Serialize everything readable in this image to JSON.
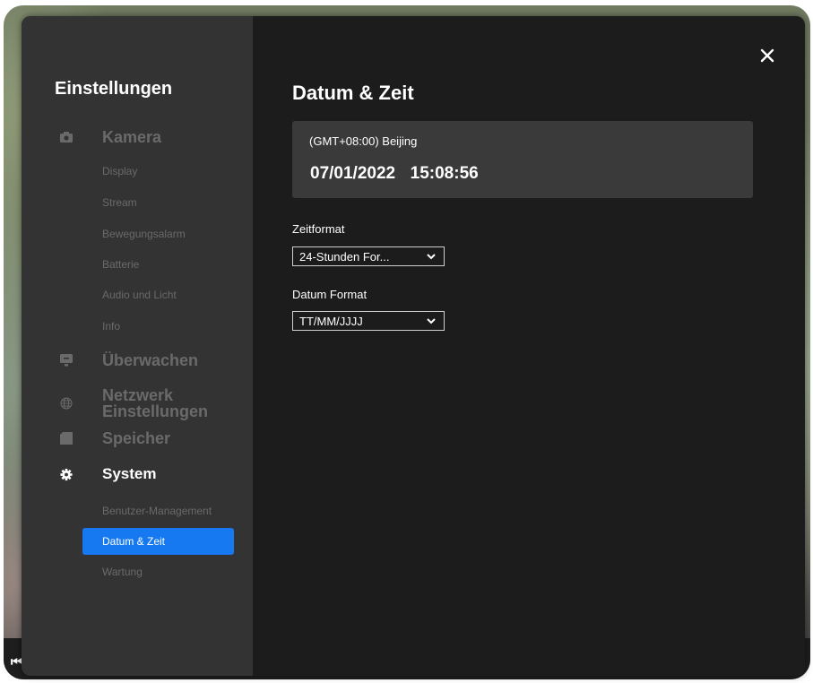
{
  "sidebar": {
    "title": "Einstellungen",
    "sections": {
      "camera": {
        "label": "Kamera",
        "icon": "camera-icon",
        "items": [
          "Display",
          "Stream",
          "Bewegungsalarm",
          "Batterie",
          "Audio und Licht",
          "Info"
        ]
      },
      "monitor": {
        "label": "Überwachen",
        "icon": "monitor-icon"
      },
      "network": {
        "label_line1": "Netzwerk",
        "label_line2": "Einstellungen",
        "icon": "globe-icon"
      },
      "storage": {
        "label": "Speicher",
        "icon": "storage-icon"
      },
      "system": {
        "label": "System",
        "icon": "gear-icon",
        "items": [
          "Benutzer-Management",
          "Datum & Zeit",
          "Wartung"
        ],
        "selected": "Datum & Zeit"
      }
    }
  },
  "main": {
    "title": "Datum & Zeit",
    "timezone": "(GMT+08:00) Beijing",
    "datetime": "07/01/2022  15:08:56",
    "time_format": {
      "label": "Zeitformat",
      "value": "24-Stunden For..."
    },
    "date_format": {
      "label": "Datum Format",
      "value": "TT/MM/JJJJ"
    }
  },
  "colors": {
    "accent": "#1679f2",
    "sidebar_bg": "#333333",
    "content_bg": "#1c1c1c",
    "panel_bg": "#3a3a3a",
    "muted_text": "#6a6a6a"
  }
}
